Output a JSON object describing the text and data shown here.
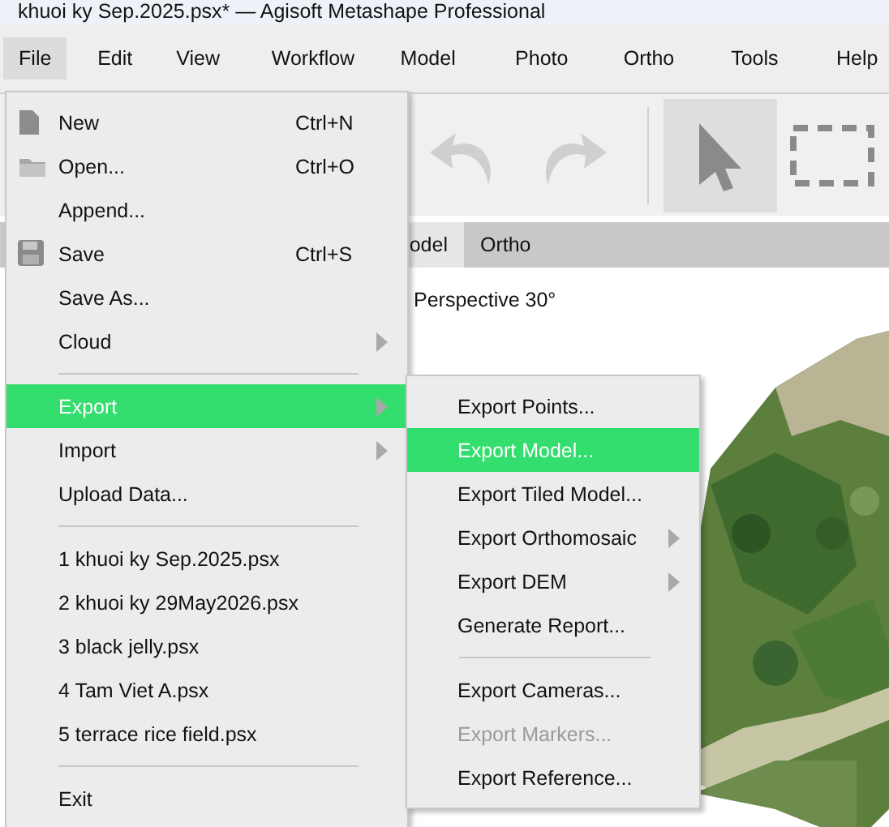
{
  "window": {
    "title": "khuoi ky Sep.2025.psx* — Agisoft Metashape Professional"
  },
  "menu_bar": [
    {
      "label": "File",
      "selected": true
    },
    {
      "label": "Edit",
      "selected": false
    },
    {
      "label": "View",
      "selected": false
    },
    {
      "label": "Workflow",
      "selected": false
    },
    {
      "label": "Model",
      "selected": false
    },
    {
      "label": "Photo",
      "selected": false
    },
    {
      "label": "Ortho",
      "selected": false
    },
    {
      "label": "Tools",
      "selected": false
    },
    {
      "label": "Help",
      "selected": false
    }
  ],
  "toolbar": [
    {
      "kind": "undo",
      "disabled": true
    },
    {
      "kind": "redo",
      "disabled": true
    },
    {
      "kind": "separator"
    },
    {
      "kind": "pointer",
      "selected": true
    },
    {
      "kind": "rect-select",
      "selected": false
    }
  ],
  "tabs": [
    {
      "label": "odel",
      "selected": true
    },
    {
      "label": "Ortho",
      "selected": false
    }
  ],
  "viewport": {
    "label": "Perspective 30°",
    "kind": "picture"
  },
  "file_menu": [
    {
      "kind": "item",
      "label": "New",
      "shortcut": "Ctrl+N",
      "selected": false
    },
    {
      "kind": "item",
      "label": "Open...",
      "shortcut": "Ctrl+O",
      "selected": false
    },
    {
      "kind": "item",
      "label": "Append...",
      "selected": false
    },
    {
      "kind": "item",
      "label": "Save",
      "shortcut": "Ctrl+S",
      "selected": false
    },
    {
      "kind": "item",
      "label": "Save As...",
      "selected": false
    },
    {
      "kind": "submenu",
      "label": "Cloud",
      "selected": false
    },
    {
      "kind": "separator"
    },
    {
      "kind": "submenu",
      "label": "Export",
      "selected": true
    },
    {
      "kind": "submenu",
      "label": "Import",
      "selected": false
    },
    {
      "kind": "item",
      "label": "Upload Data...",
      "selected": false
    },
    {
      "kind": "separator"
    },
    {
      "kind": "item",
      "label": "1 khuoi ky Sep.2025.psx",
      "selected": false
    },
    {
      "kind": "item",
      "label": "2 khuoi ky 29May2026.psx",
      "selected": false
    },
    {
      "kind": "item",
      "label": "3 black jelly.psx",
      "selected": false
    },
    {
      "kind": "item",
      "label": "4 Tam Viet A.psx",
      "selected": false
    },
    {
      "kind": "item",
      "label": "5 terrace rice field.psx",
      "selected": false
    },
    {
      "kind": "separator"
    },
    {
      "kind": "item",
      "label": "Exit",
      "selected": false
    }
  ],
  "export_menu": [
    {
      "kind": "item",
      "label": "Export Points...",
      "selected": false,
      "disabled": false
    },
    {
      "kind": "item",
      "label": "Export Model...",
      "selected": true,
      "disabled": false
    },
    {
      "kind": "item",
      "label": "Export Tiled Model...",
      "selected": false,
      "disabled": false
    },
    {
      "kind": "submenu",
      "label": "Export Orthomosaic",
      "selected": false,
      "disabled": false
    },
    {
      "kind": "submenu",
      "label": "Export DEM",
      "selected": false,
      "disabled": false
    },
    {
      "kind": "item",
      "label": "Generate Report...",
      "selected": false,
      "disabled": false
    },
    {
      "kind": "separator"
    },
    {
      "kind": "item",
      "label": "Export Cameras...",
      "selected": false,
      "disabled": false
    },
    {
      "kind": "item",
      "label": "Export Markers...",
      "selected": false,
      "disabled": true
    },
    {
      "kind": "item",
      "label": "Export Reference...",
      "selected": false,
      "disabled": false
    }
  ]
}
